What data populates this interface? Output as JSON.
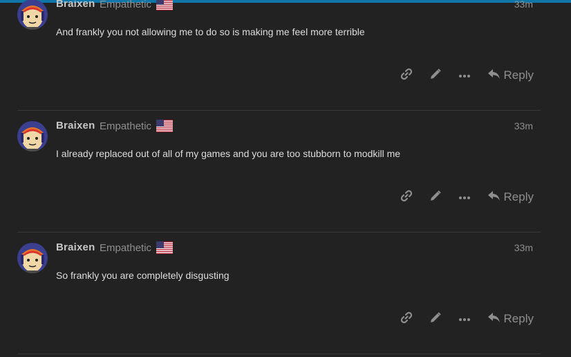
{
  "header": {
    "accent_color": "#0e76a8"
  },
  "posts": [
    {
      "author": "Braixen",
      "user_title": "Empathetic",
      "flag_icon": "us-flag-icon",
      "date": "33m",
      "text": "And frankly you not allowing me to do so is making me feel more terrible",
      "reply_label": "Reply"
    },
    {
      "author": "Braixen",
      "user_title": "Empathetic",
      "flag_icon": "us-flag-icon",
      "date": "33m",
      "text": "I already replaced out of all of my games and you are too stubborn to modkill me",
      "reply_label": "Reply"
    },
    {
      "author": "Braixen",
      "user_title": "Empathetic",
      "flag_icon": "us-flag-icon",
      "date": "33m",
      "text": "So frankly you are completely disgusting",
      "reply_label": "Reply"
    }
  ],
  "icons": {
    "link": "link-icon",
    "edit": "pencil-icon",
    "more": "ellipsis-icon",
    "reply": "reply-arrow-icon"
  },
  "colors": {
    "background": "#222222",
    "text": "#dddddd",
    "muted": "#8f8f8f",
    "divider": "#393939"
  }
}
